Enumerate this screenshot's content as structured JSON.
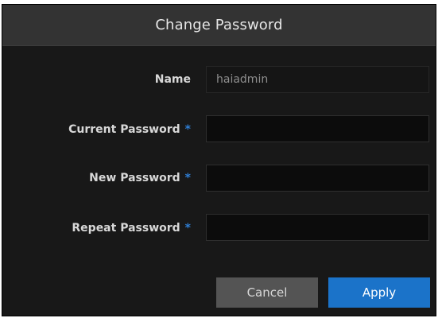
{
  "dialog": {
    "title": "Change Password",
    "required_marker": "*",
    "fields": {
      "name": {
        "label": "Name",
        "value": "haiadmin"
      },
      "current_password": {
        "label": "Current Password",
        "value": ""
      },
      "new_password": {
        "label": "New Password",
        "value": ""
      },
      "repeat_password": {
        "label": "Repeat Password",
        "value": ""
      }
    },
    "buttons": {
      "cancel": "Cancel",
      "apply": "Apply"
    }
  }
}
